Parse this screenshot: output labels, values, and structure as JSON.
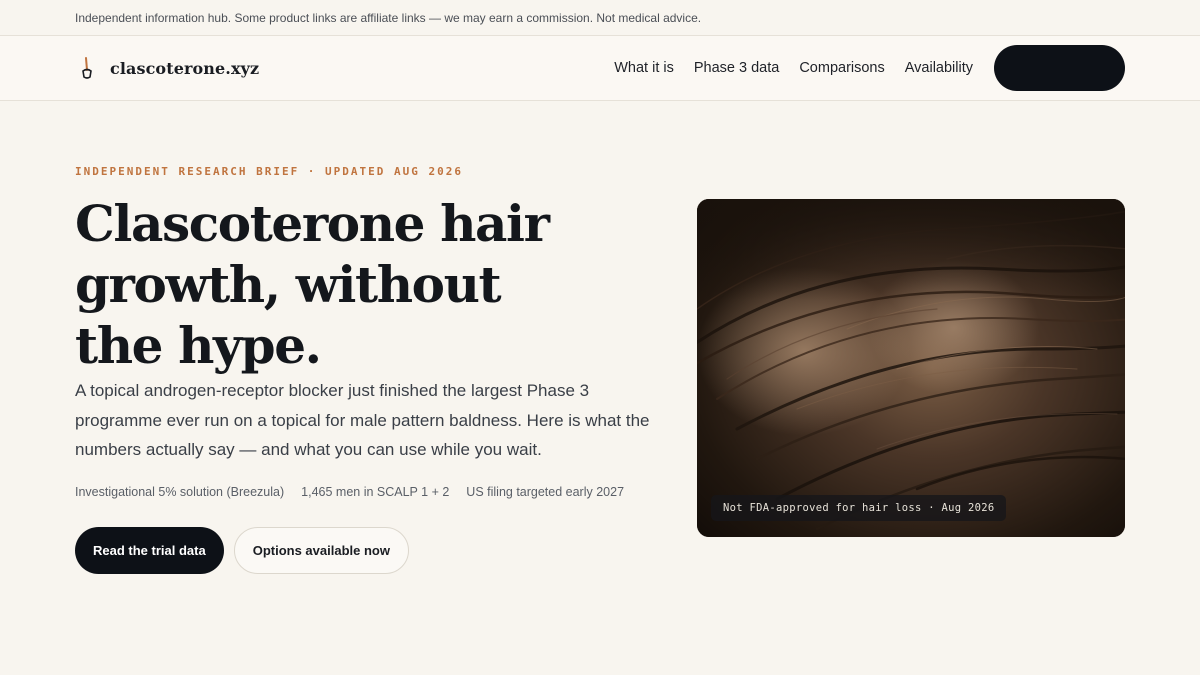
{
  "disclaimer": "Independent information hub. Some product links are affiliate links — we may earn a commission. Not medical advice.",
  "brand": {
    "name": "clascoterone.xyz",
    "icon": "brush-icon",
    "accent": "#c0743f"
  },
  "nav": {
    "items": [
      {
        "label": "What it is"
      },
      {
        "label": "Phase 3 data"
      },
      {
        "label": "Comparisons"
      },
      {
        "label": "Availability"
      }
    ],
    "cta_label": ""
  },
  "hero": {
    "eyebrow": "INDEPENDENT RESEARCH BRIEF · UPDATED AUG 2026",
    "title": "Clascoterone hair growth, without the hype.",
    "lede": "A topical androgen-receptor blocker just finished the largest Phase 3 programme ever run on a topical for male pattern baldness. Here is what the numbers actually say — and what you can use while you wait.",
    "meta": [
      "Investigational 5% solution (Breezula)",
      "1,465 men in SCALP 1 + 2",
      "US filing targeted early 2027"
    ],
    "primary_button": "Read the trial data",
    "secondary_button": "Options available now"
  },
  "photo": {
    "badge": "Not FDA-approved for hair loss · Aug 2026"
  },
  "colors": {
    "background": "#f8f5ef",
    "dark": "#0d1117",
    "accent": "#c0743f"
  }
}
